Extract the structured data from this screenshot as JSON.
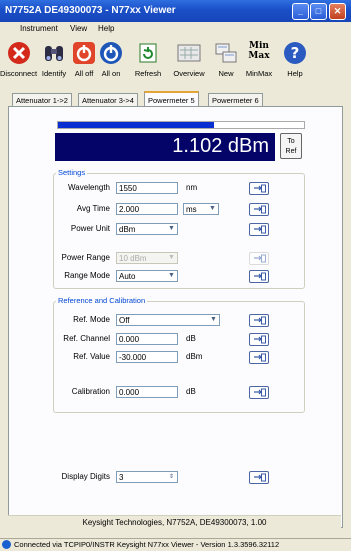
{
  "window": {
    "title": "N7752A DE49300073 - N77xx Viewer"
  },
  "menu": [
    "Instrument",
    "View",
    "Help"
  ],
  "toolbar": [
    {
      "label": "Disconnect",
      "icon": "disconnect-icon"
    },
    {
      "label": "Identify",
      "icon": "binoculars-icon"
    },
    {
      "label": "All off",
      "icon": "power-off-icon"
    },
    {
      "label": "All on",
      "icon": "power-on-icon"
    },
    {
      "label": "Refresh",
      "icon": "refresh-icon"
    },
    {
      "label": "Overview",
      "icon": "overview-icon"
    },
    {
      "label": "New",
      "icon": "new-window-icon"
    },
    {
      "label": "MinMax",
      "icon": "minmax-icon",
      "text_top": "Min",
      "text_bottom": "Max"
    },
    {
      "label": "Help",
      "icon": "help-icon"
    }
  ],
  "tabs": [
    "Attenuator 1->2",
    "Attenuator 3->4",
    "Powermeter 5",
    "Powermeter 6"
  ],
  "active_tab": "Powermeter 5",
  "power": {
    "value": "1.102 dBm",
    "bar_fraction": 0.64,
    "to_ref_line1": "To",
    "to_ref_line2": "Ref"
  },
  "settings": {
    "title": "Settings",
    "wavelength": {
      "label": "Wavelength",
      "value": "1550",
      "unit": "nm"
    },
    "avg_time": {
      "label": "Avg Time",
      "value": "2.000",
      "unit": "ms"
    },
    "power_unit": {
      "label": "Power Unit",
      "value": "dBm"
    },
    "power_range": {
      "label": "Power Range",
      "value": "10 dBm"
    },
    "range_mode": {
      "label": "Range Mode",
      "value": "Auto"
    }
  },
  "reference": {
    "title": "Reference and Calibration",
    "ref_mode": {
      "label": "Ref. Mode",
      "value": "Off"
    },
    "ref_channel": {
      "label": "Ref. Channel",
      "value": "0.000",
      "unit": "dB"
    },
    "ref_value": {
      "label": "Ref. Value",
      "value": "-30.000",
      "unit": "dBm"
    },
    "calibration": {
      "label": "Calibration",
      "value": "0.000",
      "unit": "dB"
    }
  },
  "display_digits": {
    "label": "Display Digits",
    "value": "3"
  },
  "info": "Keysight  Technologies, N7752A, DE49300073, 1.00",
  "status": "Connected via TCPIP0/INSTR Keysight N77xx Viewer - Version 1.3.3596.32112",
  "colors": {
    "display_bg": "#040468",
    "bar": "#0a2fd0",
    "title_bar": "#1a4fc8"
  }
}
